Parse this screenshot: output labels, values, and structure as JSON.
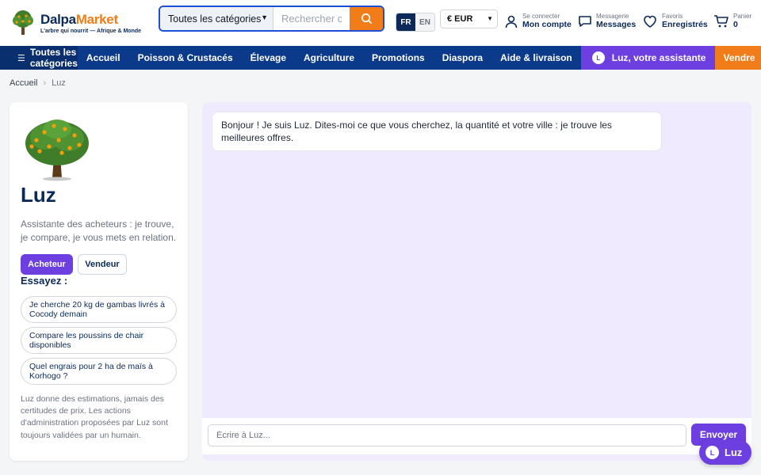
{
  "brand": {
    "name_part1": "Dalpa",
    "name_part2": "Market",
    "tagline": "L'arbre qui nourrit — Afrique & Monde",
    "colors": {
      "navy": "#0b2a59",
      "orange": "#f07d1a",
      "purple": "#6d3fe0",
      "nav_blue": "#0b3a8a"
    }
  },
  "search": {
    "category": "Toutes les catégories",
    "placeholder": "Rechercher des produits...",
    "icon": "search-icon"
  },
  "language": {
    "active": "FR",
    "other": "EN"
  },
  "currency": "€ EUR",
  "header_items": {
    "account": {
      "small": "Se connecter",
      "label": "Mon compte",
      "icon": "user-icon"
    },
    "messages": {
      "small": "Messagerie",
      "label": "Messages",
      "icon": "chat-icon"
    },
    "favorites": {
      "small": "Favoris",
      "label": "Enregistrés",
      "icon": "heart-icon"
    },
    "cart": {
      "small": "Panier",
      "label": "0",
      "icon": "cart-icon"
    }
  },
  "nav": {
    "all_categories": "Toutes les catégories",
    "items": [
      "Accueil",
      "Poisson & Crustacés",
      "Élevage",
      "Agriculture",
      "Promotions",
      "Diaspora",
      "Aide & livraison"
    ],
    "luz_badge": "L",
    "luz_label": "Luz, votre assistante",
    "vendor_label": "Vendre"
  },
  "breadcrumb": {
    "home": "Accueil",
    "current": "Luz"
  },
  "assistant": {
    "name": "Luz",
    "description": "Assistante des acheteurs : je trouve, je compare, je vous mets en relation.",
    "modes": {
      "buyer": "Acheteur",
      "seller": "Vendeur"
    },
    "try_heading": "Essayez :",
    "suggestions": [
      "Je cherche 20 kg de gambas livrés à Cocody demain",
      "Compare les poussins de chair disponibles",
      "Quel engrais pour 2 ha de maïs à Korhogo ?"
    ],
    "disclaimer": "Luz donne des estimations, jamais des certitudes de prix. Les actions d'administration proposées par Luz sont toujours validées par un humain."
  },
  "chat": {
    "messages": [
      "Bonjour ! Je suis Luz. Dites-moi ce que vous cherchez, la quantité et votre ville : je trouve les meilleures offres."
    ],
    "input_placeholder": "Écrire à Luz...",
    "send_label": "Envoyer"
  },
  "fab": {
    "badge": "L",
    "label": "Luz"
  }
}
